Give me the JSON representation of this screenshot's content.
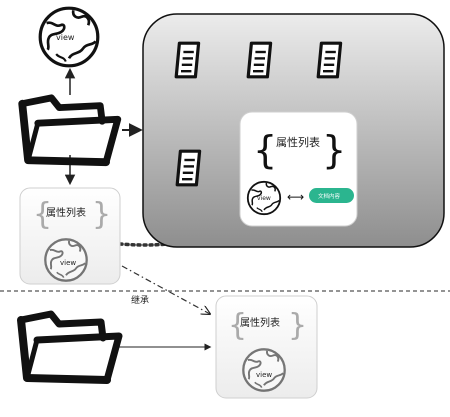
{
  "folder_top": {
    "view_label": "view",
    "icons": [
      "folder-icon",
      "globe-icon"
    ]
  },
  "container": {
    "docs": [
      "document-icon",
      "document-icon",
      "document-icon",
      "document-icon"
    ],
    "inner_card": {
      "prop_list_label": "属性列表",
      "view_label": "view",
      "doc_content_button": "文档内容",
      "button_color": "#2bb58f"
    }
  },
  "left_card": {
    "prop_list_label": "属性列表",
    "view_label": "view"
  },
  "divider": {
    "inherit_label": "继承"
  },
  "bottom_card": {
    "prop_list_label": "属性列表",
    "view_label": "view"
  },
  "colors": {
    "gray_dark": "#8c8c8c",
    "gray_light": "#ececec",
    "stroke": "#111111"
  }
}
